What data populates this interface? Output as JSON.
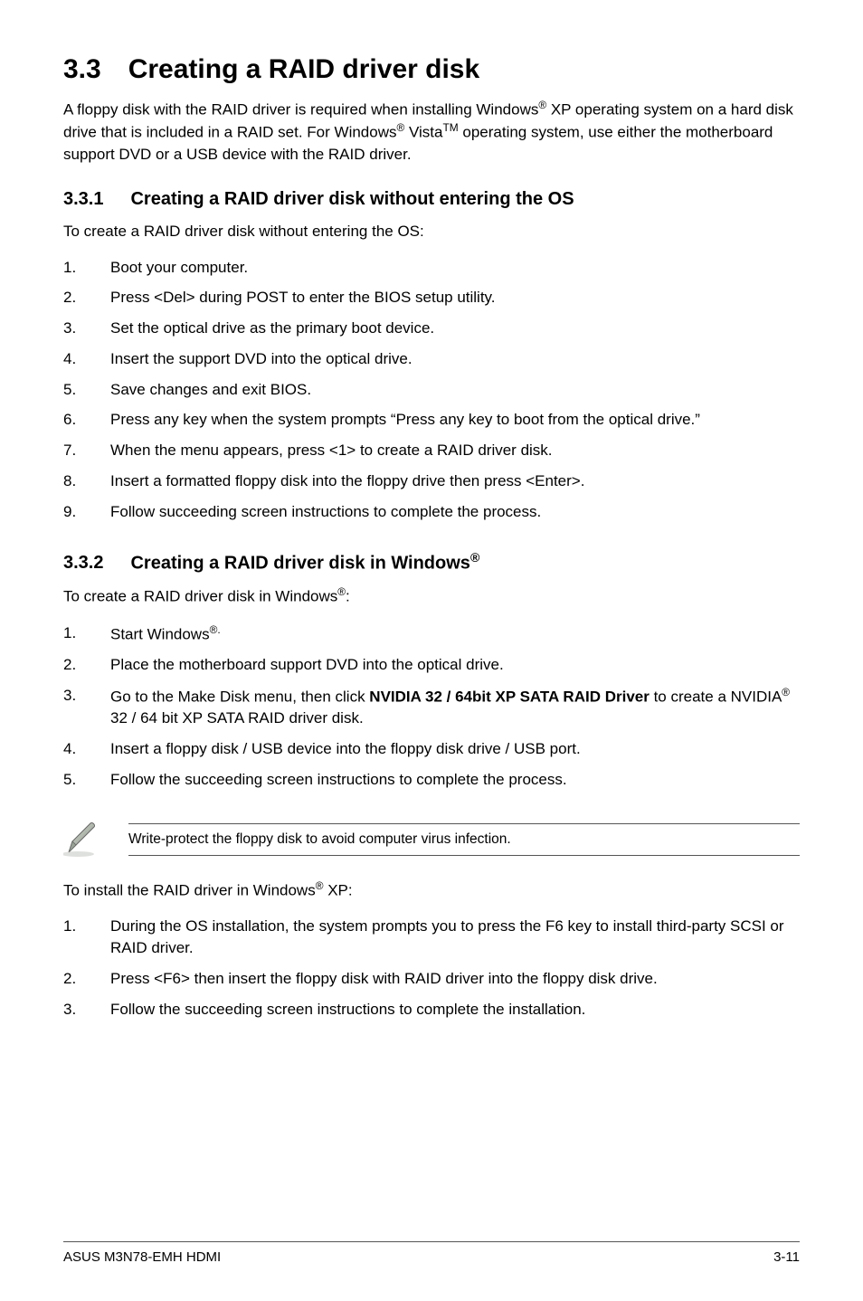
{
  "main": {
    "num": "3.3",
    "title": "Creating a RAID driver disk"
  },
  "intro_parts": {
    "p1": "A floppy disk with the RAID driver is required when installing Windows",
    "p2": " XP operating system on a hard disk drive that is included in a RAID set. For Windows",
    "p3": " Vista",
    "p4": " operating system, use either the motherboard support DVD or a USB device with the RAID driver."
  },
  "sec1": {
    "num": "3.3.1",
    "title": "Creating a RAID driver disk without entering the OS",
    "intro": "To create a RAID driver disk without entering the OS:",
    "items": [
      "Boot your computer.",
      "Press <Del> during POST to enter the BIOS setup utility.",
      "Set the optical drive as the primary boot device.",
      "Insert the support DVD into the optical drive.",
      "Save changes and exit BIOS.",
      "Press any key when the system prompts “Press any key to boot from the optical drive.”",
      "When the menu appears, press <1> to create a RAID driver disk.",
      "Insert a formatted floppy disk into the floppy drive then press <Enter>.",
      "Follow succeeding screen instructions to complete the process."
    ]
  },
  "sec2": {
    "num": "3.3.2",
    "title_pre": "Creating a RAID driver disk in Windows",
    "intro_pre": "To create a RAID driver disk in Windows",
    "intro_post": ":",
    "items": {
      "i1_pre": "Start Windows",
      "i2": "Place the motherboard support DVD into the optical drive.",
      "i3_pre": "Go to the Make Disk menu, then click ",
      "i3_bold": "NVIDIA 32 / 64bit XP SATA RAID Driver",
      "i3_mid": " to create a NVIDIA",
      "i3_post": " 32 / 64 bit XP SATA RAID driver disk.",
      "i4": "Insert a floppy disk / USB device into the floppy disk drive / USB port.",
      "i5": "Follow the succeeding screen instructions to complete the process."
    }
  },
  "note": "Write-protect the floppy disk to avoid computer virus infection.",
  "install": {
    "intro_pre": "To install the RAID driver in Windows",
    "intro_post": " XP:",
    "items": [
      "During the OS installation, the system prompts you to press the F6 key to install third-party SCSI or RAID driver.",
      "Press <F6> then insert the floppy disk with RAID driver into the floppy disk drive.",
      "Follow the succeeding screen instructions to complete the installation."
    ]
  },
  "footer": {
    "left": "ASUS M3N78-EMH HDMI",
    "right": "3-11"
  },
  "sup": {
    "reg": "®",
    "reg_dot": "®.",
    "tm": "TM"
  }
}
